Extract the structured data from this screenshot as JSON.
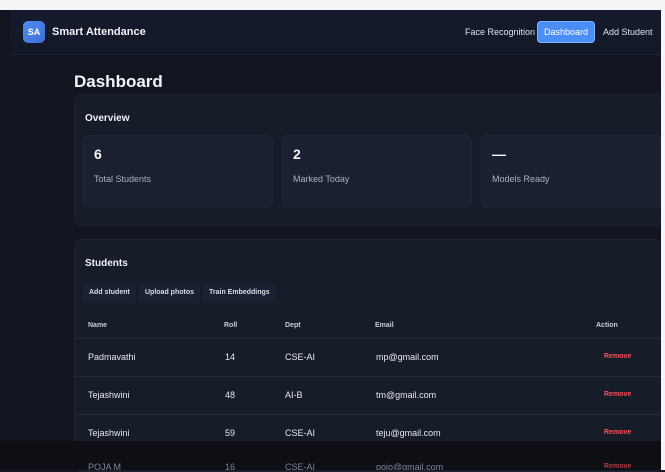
{
  "app": {
    "logo_text": "SA",
    "title": "Smart Attendance"
  },
  "nav": {
    "items": [
      {
        "label": "Face Recognition",
        "active": false
      },
      {
        "label": "Dashboard",
        "active": true
      },
      {
        "label": "Add Student",
        "active": false
      }
    ]
  },
  "page": {
    "title": "Dashboard"
  },
  "overview": {
    "title": "Overview",
    "stats": [
      {
        "value": "6",
        "label": "Total Students"
      },
      {
        "value": "2",
        "label": "Marked Today"
      },
      {
        "value": "—",
        "label": "Models Ready"
      }
    ]
  },
  "students": {
    "title": "Students",
    "toolbar": {
      "add_label": "Add student",
      "upload_label": "Upload photos",
      "train_label": "Train Embeddings"
    },
    "columns": {
      "name": "Name",
      "roll": "Roll",
      "dept": "Dept",
      "email": "Email",
      "action": "Action"
    },
    "rows": [
      {
        "name": "Padmavathi",
        "roll": "14",
        "dept": "CSE-AI",
        "email": "mp@gmail.com",
        "action": "Remove"
      },
      {
        "name": "Tejashwini",
        "roll": "48",
        "dept": "AI-B",
        "email": "tm@gmail.com",
        "action": "Remove"
      },
      {
        "name": "Tejashwini",
        "roll": "59",
        "dept": "CSE-AI",
        "email": "teju@gmail.com",
        "action": "Remove"
      },
      {
        "name": "POJA M",
        "roll": "16",
        "dept": "CSE-AI",
        "email": "pojo@gmail.com",
        "action": "Remove"
      }
    ]
  },
  "colors": {
    "accent": "#4a8ef6",
    "danger": "#ff4d5b",
    "background": "#121520",
    "card": "#171c29"
  }
}
